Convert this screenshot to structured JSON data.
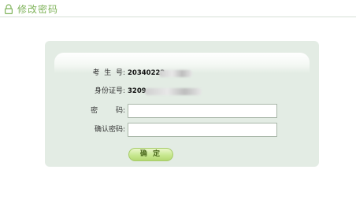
{
  "header": {
    "title": "修改密码",
    "icon": "lock-icon",
    "accent_color": "#7fb35a"
  },
  "form": {
    "candidate_no_label": "考  生  号:",
    "candidate_no_value": "20340222",
    "id_no_label": "身份证号:",
    "id_no_value": "3209",
    "password_label": "密        码:",
    "password_value": "",
    "confirm_password_label": "确认密码:",
    "confirm_password_value": "",
    "confirm_button_label": "确 定"
  }
}
